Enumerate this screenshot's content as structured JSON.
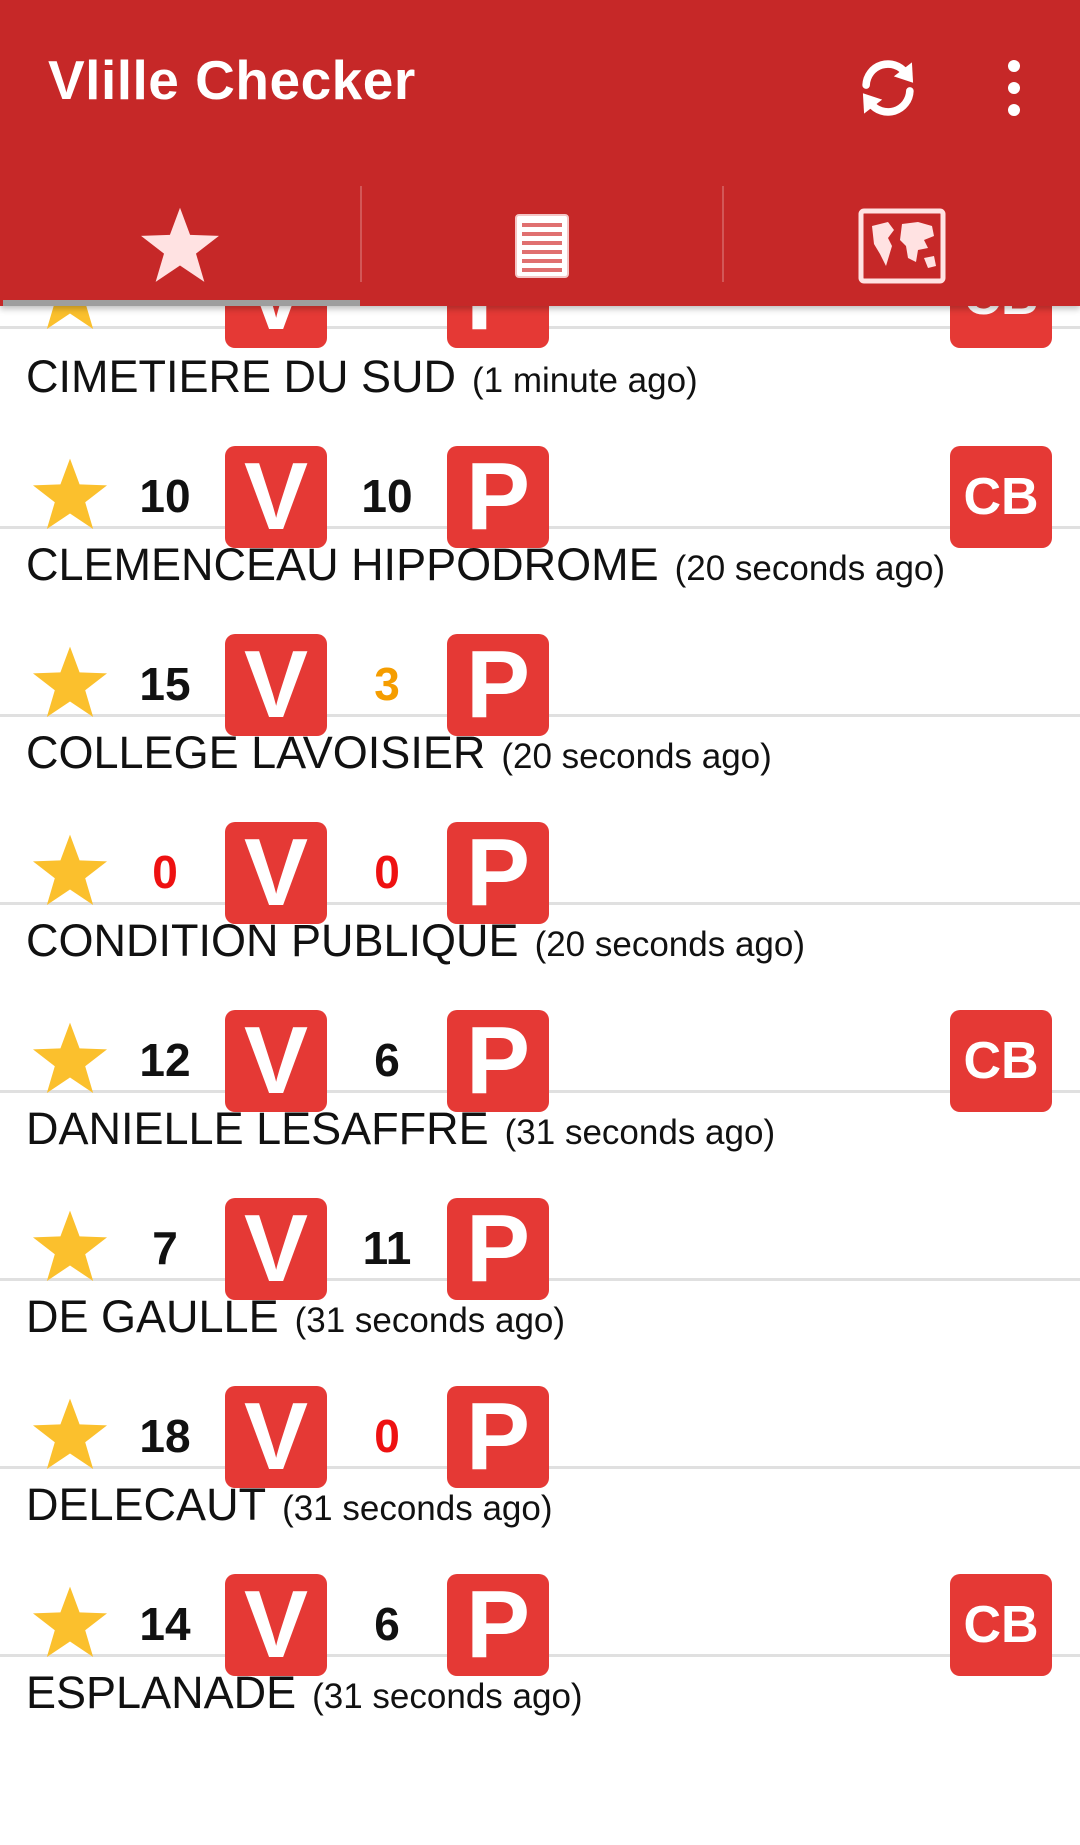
{
  "app": {
    "title": "Vlille Checker",
    "actions": {
      "refresh_icon": "refresh-icon",
      "more_icon": "more-vert-icon"
    },
    "tabs": [
      {
        "icon": "star-icon",
        "selected": true
      },
      {
        "icon": "list-icon",
        "selected": false
      },
      {
        "icon": "map-icon",
        "selected": false
      }
    ]
  },
  "colors": {
    "appbar": "#c62828",
    "badge": "#e53935",
    "star": "#fbc02d",
    "count_low": "#f59d00",
    "count_zero": "#ee1111"
  },
  "badges": {
    "bikes": "V",
    "parking": "P",
    "card": "CB"
  },
  "stations": [
    {
      "name": "",
      "ago": "",
      "bikes": "",
      "parks": "",
      "cb": true
    },
    {
      "name": "CIMETIERE DU SUD",
      "ago": "(1 minute ago)",
      "bikes": "10",
      "parks": "10",
      "cb": true
    },
    {
      "name": "CLEMENCEAU HIPPODROME",
      "ago": "(20 seconds ago)",
      "bikes": "15",
      "parks": "3",
      "cb": false
    },
    {
      "name": "COLLEGE LAVOISIER",
      "ago": "(20 seconds ago)",
      "bikes": "0",
      "parks": "0",
      "cb": false
    },
    {
      "name": "CONDITION PUBLIQUE",
      "ago": "(20 seconds ago)",
      "bikes": "12",
      "parks": "6",
      "cb": true
    },
    {
      "name": "DANIELLE LESAFFRE",
      "ago": "(31 seconds ago)",
      "bikes": "7",
      "parks": "11",
      "cb": false
    },
    {
      "name": "DE GAULLE",
      "ago": "(31 seconds ago)",
      "bikes": "18",
      "parks": "0",
      "cb": false
    },
    {
      "name": "DELECAUT",
      "ago": "(31 seconds ago)",
      "bikes": "14",
      "parks": "6",
      "cb": true
    },
    {
      "name": "ESPLANADE",
      "ago": "(31 seconds ago)",
      "bikes": "",
      "parks": "",
      "cb": false
    }
  ]
}
